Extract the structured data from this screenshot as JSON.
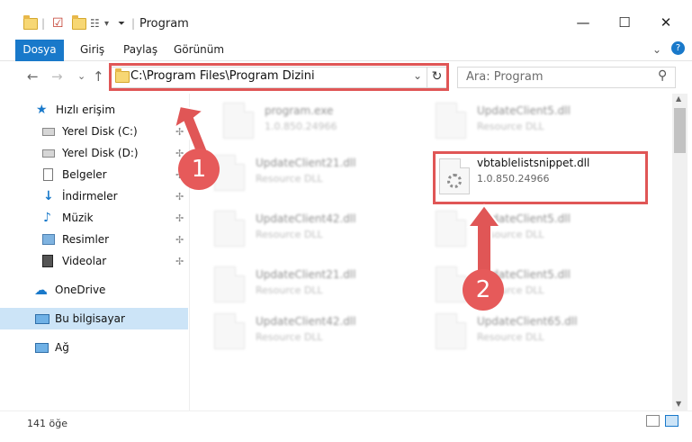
{
  "window": {
    "title": "Program",
    "controls": {
      "minimize": "—",
      "maximize": "☐",
      "close": "✕"
    }
  },
  "ribbon": {
    "tabs": [
      "Dosya",
      "Giriş",
      "Paylaş",
      "Görünüm"
    ],
    "expand_icon": "⌄",
    "help_icon": "?"
  },
  "nav": {
    "back": "←",
    "forward": "→",
    "recent": "⌄",
    "up": "↑",
    "address": "C:\\Program Files\\Program Dizini",
    "address_dropdown": "⌄",
    "refresh": "↻",
    "search_placeholder": "Ara: Program",
    "search_icon": "⚲"
  },
  "sidebar": {
    "quick_access": "Hızlı erişim",
    "items": [
      {
        "label": "Yerel Disk (C:)",
        "icon": "drive-icon"
      },
      {
        "label": "Yerel Disk (D:)",
        "icon": "drive-icon"
      },
      {
        "label": "Belgeler",
        "icon": "documents-icon"
      },
      {
        "label": "İndirmeler",
        "icon": "downloads-icon"
      },
      {
        "label": "Müzik",
        "icon": "music-icon"
      },
      {
        "label": "Resimler",
        "icon": "pictures-icon"
      },
      {
        "label": "Videolar",
        "icon": "videos-icon"
      }
    ],
    "onedrive": "OneDrive",
    "this_pc": "Bu bilgisayar",
    "network": "Ağ",
    "pin_glyph": "📌"
  },
  "files": {
    "highlighted": {
      "name": "vbtablelistsnippet.dll",
      "version": "1.0.850.24966"
    },
    "others": [
      {
        "name": "program.exe",
        "desc": "1.0.850.24966"
      },
      {
        "name": "UpdateClient5.dll",
        "desc": "Resource DLL"
      },
      {
        "name": "UpdateClient21.dll",
        "desc": "Resource DLL"
      },
      {
        "name": "UpdateClient42.dll",
        "desc": "Resource DLL"
      },
      {
        "name": "UpdateClient5.dll",
        "desc": "Resource DLL"
      },
      {
        "name": "UpdateClient21.dll",
        "desc": "Resource DLL"
      },
      {
        "name": "UpdateClient5.dll",
        "desc": "Resource DLL"
      },
      {
        "name": "UpdateClient42.dll",
        "desc": "Resource DLL"
      },
      {
        "name": "UpdateClient65.dll",
        "desc": "Resource DLL"
      }
    ]
  },
  "status": {
    "count": "141 öğe"
  },
  "annotations": {
    "badge1": "1",
    "badge2": "2",
    "color": "#e05656"
  }
}
